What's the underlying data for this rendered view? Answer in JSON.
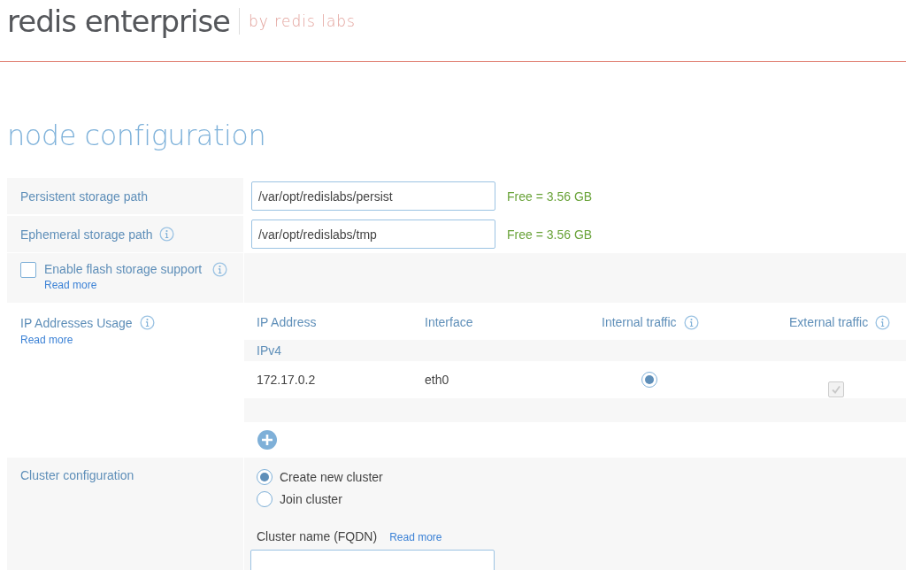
{
  "header": {
    "logo": "redis enterprise",
    "tagline": "by redis labs"
  },
  "page_title": "node configuration",
  "storage_rows": [
    {
      "label": "Persistent storage path",
      "info": false,
      "value": "/var/opt/redislabs/persist",
      "free": "Free = 3.56 GB"
    },
    {
      "label": "Ephemeral storage path",
      "info": true,
      "value": "/var/opt/redislabs/tmp",
      "free": "Free = 3.56 GB"
    }
  ],
  "flash": {
    "label": "Enable flash storage support",
    "checked": false,
    "link": "Read more"
  },
  "ip_usage": {
    "label": "IP Addresses Usage",
    "link": "Read more",
    "columns": [
      {
        "label": "IP Address",
        "info": false
      },
      {
        "label": "Interface",
        "info": false
      },
      {
        "label": "Internal traffic",
        "info": true
      },
      {
        "label": "External traffic",
        "info": true
      }
    ],
    "group": "IPv4",
    "rows": [
      {
        "address": "172.17.0.2",
        "interface": "eth0",
        "internal_selected": true,
        "external_checked": true,
        "external_disabled": true
      }
    ]
  },
  "cluster": {
    "label": "Cluster configuration",
    "options": [
      {
        "label": "Create new cluster",
        "selected": true
      },
      {
        "label": "Join cluster",
        "selected": false
      }
    ],
    "name_label": "Cluster name (FQDN)",
    "name_link": "Read more"
  }
}
